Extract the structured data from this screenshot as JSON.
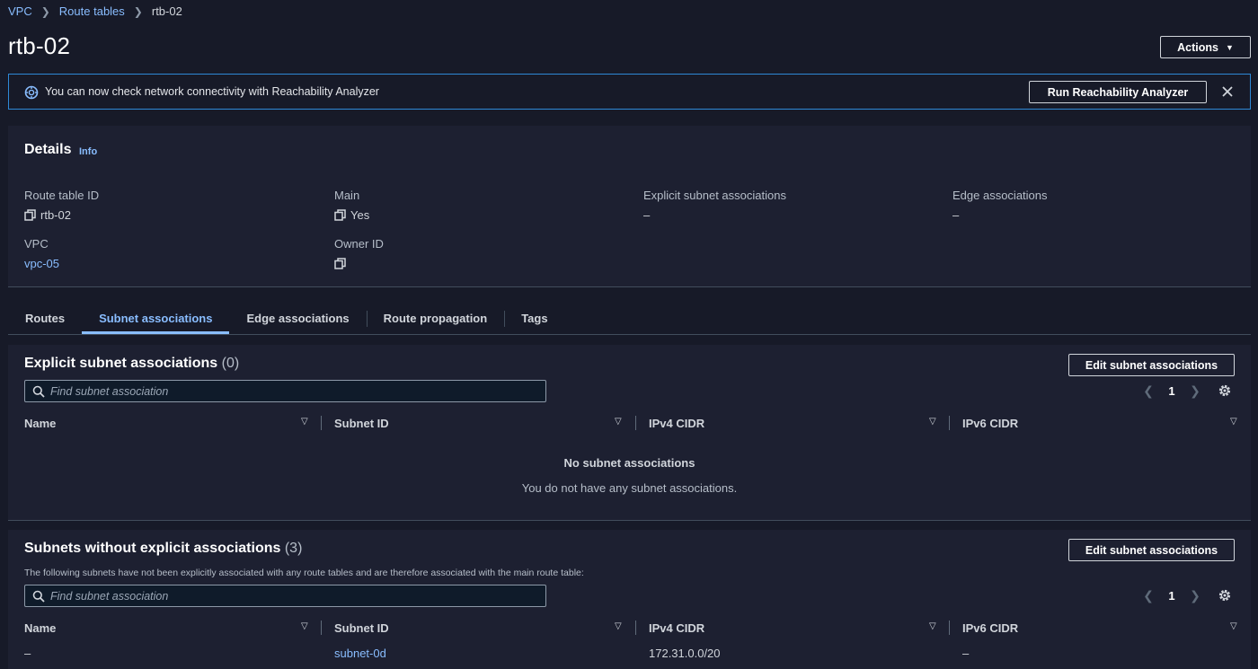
{
  "breadcrumb": {
    "vpc": "VPC",
    "route_tables": "Route tables",
    "current": "rtb-02"
  },
  "page": {
    "title": "rtb-02",
    "actions_label": "Actions"
  },
  "flash": {
    "text": "You can now check network connectivity with Reachability Analyzer",
    "button_label": "Run Reachability Analyzer"
  },
  "details": {
    "heading": "Details",
    "info_label": "Info",
    "fields": {
      "route_table_id_label": "Route table ID",
      "route_table_id_value": "rtb-02",
      "main_label": "Main",
      "main_value": "Yes",
      "explicit_label": "Explicit subnet associations",
      "explicit_value": "–",
      "edge_label": "Edge associations",
      "edge_value": "–",
      "vpc_label": "VPC",
      "vpc_value": "vpc-05",
      "owner_label": "Owner ID",
      "owner_value": ""
    }
  },
  "tabs": [
    "Routes",
    "Subnet associations",
    "Edge associations",
    "Route propagation",
    "Tags"
  ],
  "explicit": {
    "title": "Explicit subnet associations",
    "count": "(0)",
    "edit_label": "Edit subnet associations",
    "search_placeholder": "Find subnet association",
    "page": "1",
    "columns": [
      "Name",
      "Subnet ID",
      "IPv4 CIDR",
      "IPv6 CIDR"
    ],
    "empty_title": "No subnet associations",
    "empty_sub": "You do not have any subnet associations."
  },
  "without": {
    "title": "Subnets without explicit associations",
    "count": "(3)",
    "description": "The following subnets have not been explicitly associated with any route tables and are therefore associated with the main route table:",
    "edit_label": "Edit subnet associations",
    "search_placeholder": "Find subnet association",
    "page": "1",
    "columns": [
      "Name",
      "Subnet ID",
      "IPv4 CIDR",
      "IPv6 CIDR"
    ],
    "rows": [
      {
        "name": "–",
        "subnet_id": "subnet-0d",
        "ipv4": "172.31.0.0/20",
        "ipv6": "–"
      }
    ]
  },
  "colors": {
    "background": "#171a28",
    "panel": "#1d2031",
    "link": "#89bdff",
    "info_border": "#2e89d6"
  }
}
